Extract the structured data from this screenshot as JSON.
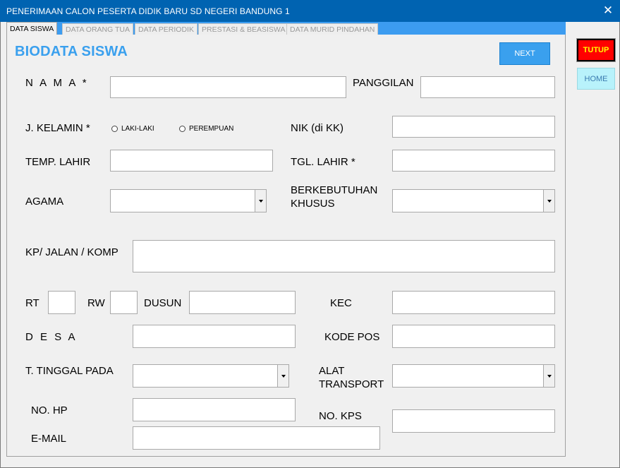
{
  "window": {
    "title": "PENERIMAAN CALON PESERTA DIDIK BARU SD NEGERI BANDUNG 1",
    "close_glyph": "✕"
  },
  "tabs": [
    {
      "label": "DATA SISWA",
      "active": true
    },
    {
      "label": "DATA ORANG TUA",
      "active": false
    },
    {
      "label": "DATA PERIODIK",
      "active": false
    },
    {
      "label": "PRESTASI & BEASISWA",
      "active": false
    },
    {
      "label": "DATA MURID PINDAHAN",
      "active": false
    }
  ],
  "heading": "BIODATA SISWA",
  "buttons": {
    "next": "NEXT",
    "tutup": "TUTUP",
    "home": "HOME"
  },
  "labels": {
    "nama": "N A M A *",
    "panggilan": "PANGGILAN",
    "jkelamin": "J. KELAMIN *",
    "nik": "NIK (di KK)",
    "temp_lahir": "TEMP. LAHIR",
    "tgl_lahir": "TGL. LAHIR *",
    "agama": "AGAMA",
    "berkebutuhan_1": "BERKEBUTUHAN",
    "berkebutuhan_2": "KHUSUS",
    "jalan": "KP/ JALAN / KOMP",
    "rt": "RT",
    "rw": "RW",
    "dusun": "DUSUN",
    "kec": "KEC",
    "desa": "D E S A",
    "kode_pos": "KODE POS",
    "tinggal": "T. TINGGAL PADA",
    "transport_1": "ALAT",
    "transport_2": "TRANSPORT",
    "no_hp": "NO. HP",
    "no_kps": "NO. KPS",
    "email": "E-MAIL"
  },
  "radios": {
    "laki": "LAKI-LAKI",
    "perempuan": "PEREMPUAN"
  },
  "fields": {
    "nama": "",
    "panggilan": "",
    "nik": "",
    "temp_lahir": "",
    "tgl_lahir": "",
    "agama": "",
    "berkebutuhan": "",
    "jalan": "",
    "rt": "",
    "rw": "",
    "dusun": "",
    "kec": "",
    "desa": "",
    "kode_pos": "",
    "tinggal": "",
    "transport": "",
    "no_hp": "",
    "no_kps": "",
    "email": ""
  },
  "colors": {
    "titlebar": "#0063b1",
    "accent": "#3aa0ee",
    "tutup_bg": "#ff0000",
    "tutup_text": "#ffff00",
    "home_bg": "#b8f2fb"
  }
}
